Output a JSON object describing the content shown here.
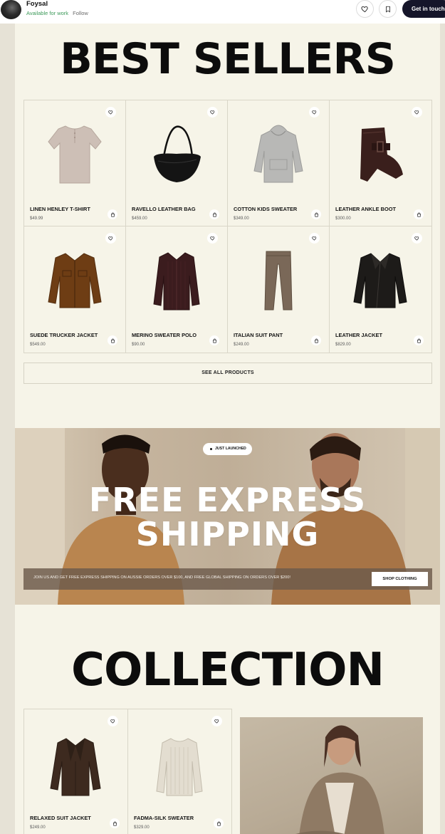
{
  "topbar": {
    "author": "Foysal",
    "status": "Available for work",
    "follow": "Follow",
    "cta": "Get in touch",
    "like_icon": "heart-icon",
    "save_icon": "bookmark-icon"
  },
  "best_sellers": {
    "title": "BEST SELLERS",
    "products": [
      {
        "name": "LINEN HENLEY T-SHIRT",
        "price": "$49.99",
        "icon": "henley-shirt"
      },
      {
        "name": "RAVELLO LEATHER BAG",
        "price": "$459.00",
        "icon": "leather-bag"
      },
      {
        "name": "COTTON KIDS SWEATER",
        "price": "$349.00",
        "icon": "hoodie"
      },
      {
        "name": "LEATHER ANKLE BOOT",
        "price": "$300.00",
        "icon": "ankle-boot"
      },
      {
        "name": "SUEDE TRUCKER JACKET",
        "price": "$549.00",
        "icon": "trucker-jacket"
      },
      {
        "name": "MERINO SWEATER POLO",
        "price": "$90.00",
        "icon": "polo-sweater"
      },
      {
        "name": "ITALIAN SUIT PANT",
        "price": "$249.00",
        "icon": "suit-pant"
      },
      {
        "name": "LEATHER JACKET",
        "price": "$829.00",
        "icon": "leather-jacket"
      }
    ],
    "see_all": "SEE ALL PRODUCTS"
  },
  "hero": {
    "badge": "JUST LAUNCHED",
    "title_line1": "FREE EXPRESS",
    "title_line2": "SHIPPING",
    "strip_text": "JOIN US AND GET FREE EXPRESS SHIPPING ON AUSSIE ORDERS OVER $100, AND FREE GLOBAL SHIPPING ON ORDERS OVER $200!",
    "button": "SHOP CLOTHING"
  },
  "collection": {
    "title": "COLLECTION",
    "products": [
      {
        "name": "RELAXED SUIT JACKET",
        "price": "$249.00",
        "icon": "suit-jacket"
      },
      {
        "name": "FADMA-SILK SWEATER",
        "price": "$329.00",
        "icon": "knit-sweater"
      }
    ]
  },
  "colors": {
    "page_bg": "#f6f4e8",
    "outer_bg": "#e6e2d6",
    "cta_bg": "#15152a",
    "status_green": "#3d9a5a"
  }
}
